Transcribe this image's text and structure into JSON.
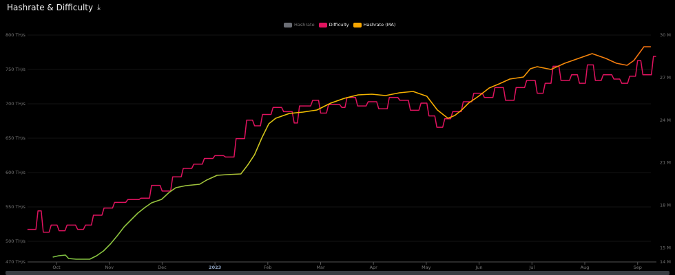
{
  "header": {
    "title": "Hashrate & Difficulty",
    "download_icon": "download-icon"
  },
  "chart_data": {
    "type": "line",
    "title": "Hashrate & Difficulty",
    "legend": [
      {
        "name": "Hashrate",
        "color": "#6b6e75",
        "hidden": true
      },
      {
        "name": "Difficulty",
        "color": "#e0135f"
      },
      {
        "name": "Hashrate (MA)",
        "color": "#f7a600"
      }
    ],
    "legend_position": "top-center",
    "x_ticks": [
      "Oct",
      "Nov",
      "Dec",
      "2023",
      "Feb",
      "Mar",
      "Apr",
      "May",
      "Jun",
      "Jul",
      "Aug",
      "Sep"
    ],
    "x_unit": "months since Oct 2022",
    "y_left": {
      "ticks": [
        "800 TH/s",
        "750 TH/s",
        "700 TH/s",
        "650 TH/s",
        "600 TH/s",
        "550 TH/s",
        "500 TH/s",
        "470 TH/s"
      ],
      "values": [
        800,
        750,
        700,
        650,
        600,
        550,
        500,
        470
      ],
      "range": [
        470,
        800
      ]
    },
    "y_right": {
      "ticks": [
        "30 M",
        "27 M",
        "24 M",
        "21 M",
        "18 M",
        "15 M",
        "14 M"
      ],
      "values": [
        30,
        27,
        24,
        21,
        18,
        15,
        14
      ],
      "range": [
        14,
        30
      ]
    },
    "series": [
      {
        "name": "Hashrate (MA)",
        "axis": "left",
        "points": [
          [
            -0.07,
            477
          ],
          [
            0.04,
            479
          ],
          [
            0.17,
            480
          ],
          [
            0.23,
            475
          ],
          [
            0.37,
            474
          ],
          [
            0.63,
            474
          ],
          [
            0.76,
            479
          ],
          [
            0.89,
            486
          ],
          [
            1.02,
            496
          ],
          [
            1.15,
            508
          ],
          [
            1.28,
            521
          ],
          [
            1.41,
            531
          ],
          [
            1.54,
            541
          ],
          [
            1.67,
            549
          ],
          [
            1.8,
            556
          ],
          [
            1.99,
            561
          ],
          [
            2.13,
            571
          ],
          [
            2.26,
            578
          ],
          [
            2.45,
            581
          ],
          [
            2.71,
            583
          ],
          [
            2.84,
            589
          ],
          [
            3.04,
            596
          ],
          [
            3.23,
            597
          ],
          [
            3.49,
            598
          ],
          [
            3.62,
            611
          ],
          [
            3.75,
            626
          ],
          [
            3.89,
            651
          ],
          [
            4.02,
            671
          ],
          [
            4.15,
            679
          ],
          [
            4.41,
            686
          ],
          [
            4.67,
            688
          ],
          [
            4.93,
            691
          ],
          [
            5.19,
            701
          ],
          [
            5.45,
            708
          ],
          [
            5.71,
            713
          ],
          [
            5.97,
            714
          ],
          [
            6.23,
            712
          ],
          [
            6.49,
            716
          ],
          [
            6.75,
            718
          ],
          [
            7.01,
            711
          ],
          [
            7.21,
            691
          ],
          [
            7.41,
            679
          ],
          [
            7.54,
            683
          ],
          [
            7.67,
            691
          ],
          [
            7.8,
            701
          ],
          [
            7.99,
            711
          ],
          [
            8.19,
            723
          ],
          [
            8.38,
            729
          ],
          [
            8.58,
            736
          ],
          [
            8.84,
            739
          ],
          [
            8.97,
            751
          ],
          [
            9.1,
            754
          ],
          [
            9.36,
            750
          ],
          [
            9.62,
            759
          ],
          [
            9.88,
            766
          ],
          [
            10.14,
            773
          ],
          [
            10.4,
            766
          ],
          [
            10.6,
            759
          ],
          [
            10.8,
            756
          ],
          [
            10.93,
            763
          ],
          [
            11.12,
            783
          ],
          [
            11.25,
            783
          ]
        ]
      },
      {
        "name": "Difficulty",
        "axis": "right",
        "points": [
          [
            -0.55,
            16.3
          ],
          [
            -0.35,
            17.6
          ],
          [
            -0.25,
            16.1
          ],
          [
            -0.1,
            16.6
          ],
          [
            0.05,
            16.2
          ],
          [
            0.2,
            16.6
          ],
          [
            0.4,
            16.3
          ],
          [
            0.55,
            16.6
          ],
          [
            0.7,
            17.3
          ],
          [
            0.9,
            17.8
          ],
          [
            1.1,
            18.2
          ],
          [
            1.35,
            18.4
          ],
          [
            1.6,
            18.5
          ],
          [
            1.8,
            19.4
          ],
          [
            2.0,
            19.0
          ],
          [
            2.2,
            20.0
          ],
          [
            2.4,
            20.6
          ],
          [
            2.6,
            20.9
          ],
          [
            2.8,
            21.3
          ],
          [
            3.0,
            21.5
          ],
          [
            3.2,
            21.4
          ],
          [
            3.4,
            22.7
          ],
          [
            3.6,
            24.0
          ],
          [
            3.75,
            23.6
          ],
          [
            3.9,
            24.4
          ],
          [
            4.1,
            24.9
          ],
          [
            4.3,
            24.6
          ],
          [
            4.5,
            23.8
          ],
          [
            4.6,
            25.0
          ],
          [
            4.85,
            25.4
          ],
          [
            5.0,
            24.5
          ],
          [
            5.15,
            25.1
          ],
          [
            5.4,
            24.9
          ],
          [
            5.5,
            25.6
          ],
          [
            5.7,
            25.0
          ],
          [
            5.9,
            25.3
          ],
          [
            6.1,
            24.8
          ],
          [
            6.3,
            25.6
          ],
          [
            6.5,
            25.4
          ],
          [
            6.7,
            24.7
          ],
          [
            6.9,
            25.2
          ],
          [
            7.05,
            24.3
          ],
          [
            7.2,
            23.5
          ],
          [
            7.35,
            24.1
          ],
          [
            7.5,
            24.6
          ],
          [
            7.7,
            25.3
          ],
          [
            7.9,
            25.9
          ],
          [
            8.1,
            25.6
          ],
          [
            8.3,
            26.3
          ],
          [
            8.5,
            25.4
          ],
          [
            8.7,
            26.3
          ],
          [
            8.9,
            26.8
          ],
          [
            9.1,
            25.9
          ],
          [
            9.25,
            26.6
          ],
          [
            9.4,
            27.8
          ],
          [
            9.55,
            26.8
          ],
          [
            9.75,
            27.2
          ],
          [
            9.9,
            26.6
          ],
          [
            10.05,
            27.9
          ],
          [
            10.2,
            26.8
          ],
          [
            10.35,
            27.2
          ],
          [
            10.55,
            26.9
          ],
          [
            10.7,
            26.6
          ],
          [
            10.85,
            27.1
          ],
          [
            11.0,
            28.2
          ],
          [
            11.1,
            27.2
          ],
          [
            11.3,
            28.5
          ],
          [
            11.35,
            28.5
          ]
        ]
      }
    ]
  }
}
